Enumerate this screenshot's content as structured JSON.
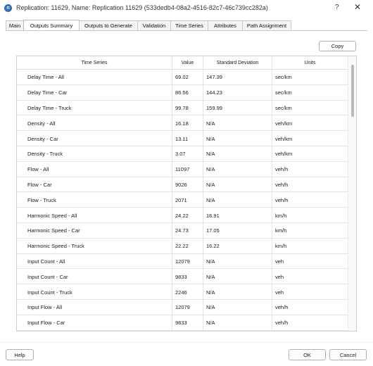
{
  "window": {
    "icon_letter": "n",
    "title": "Replication: 11629, Name: Replication 11629  (533dedb4-08a2-4516-82c7-46c739cc282a)",
    "help_glyph": "?",
    "close_glyph": "✕"
  },
  "tabs": [
    {
      "label": "Main",
      "active": false
    },
    {
      "label": "Outputs Summary",
      "active": true
    },
    {
      "label": "Outputs to Generate",
      "active": false
    },
    {
      "label": "Validation",
      "active": false
    },
    {
      "label": "Time Series",
      "active": false
    },
    {
      "label": "Attributes",
      "active": false
    },
    {
      "label": "Path Assignment",
      "active": false
    }
  ],
  "toolbar": {
    "copy_label": "Copy"
  },
  "table": {
    "columns": [
      "Time Series",
      "Value",
      "Standard Deviation",
      "Units"
    ],
    "rows": [
      [
        "Delay Time - All",
        "69.02",
        "147.39",
        "sec/km"
      ],
      [
        "Delay Time - Car",
        "86.56",
        "144.23",
        "sec/km"
      ],
      [
        "Delay Time - Truck",
        "99.78",
        "159.99",
        "sec/km"
      ],
      [
        "Density - All",
        "16.18",
        "N/A",
        "veh/km"
      ],
      [
        "Density - Car",
        "13.11",
        "N/A",
        "veh/km"
      ],
      [
        "Density - Truck",
        "3.07",
        "N/A",
        "veh/km"
      ],
      [
        "Flow - All",
        "11097",
        "N/A",
        "veh/h"
      ],
      [
        "Flow - Car",
        "9026",
        "N/A",
        "veh/h"
      ],
      [
        "Flow - Truck",
        "2071",
        "N/A",
        "veh/h"
      ],
      [
        "Harmonic Speed - All",
        "24.22",
        "16.91",
        "km/h"
      ],
      [
        "Harmonic Speed - Car",
        "24.73",
        "17.05",
        "km/h"
      ],
      [
        "Harmonic Speed - Truck",
        "22.22",
        "16.22",
        "km/h"
      ],
      [
        "Input Count - All",
        "12079",
        "N/A",
        "veh"
      ],
      [
        "Input Count - Car",
        "9833",
        "N/A",
        "veh"
      ],
      [
        "Input Count - Truck",
        "2246",
        "N/A",
        "veh"
      ],
      [
        "Input Flow - All",
        "12079",
        "N/A",
        "veh/h"
      ],
      [
        "Input Flow - Car",
        "9833",
        "N/A",
        "veh/h"
      ],
      [
        "",
        "",
        "",
        ""
      ]
    ]
  },
  "footer": {
    "help_label": "Help",
    "ok_label": "OK",
    "cancel_label": "Cancel"
  }
}
